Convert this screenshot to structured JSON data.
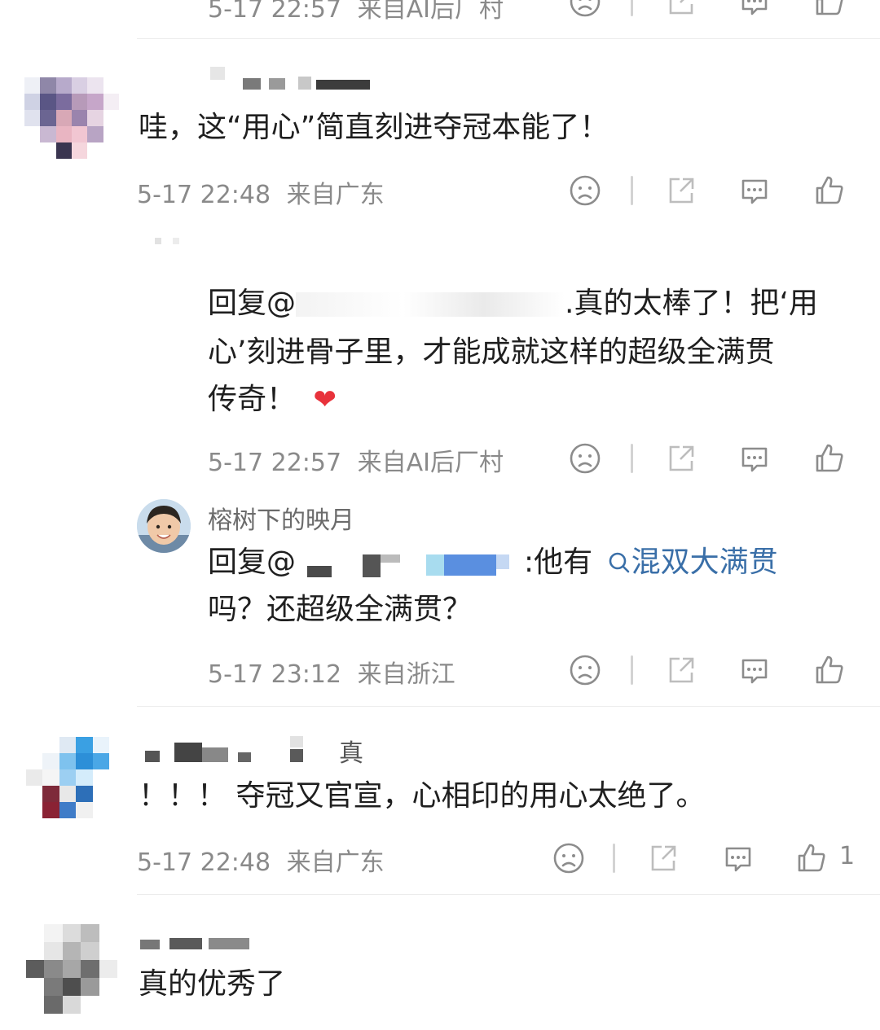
{
  "comments": [
    {
      "meta": {
        "time": "5-17 22:57",
        "location": "来自AI后厂村"
      }
    },
    {
      "text": "哇，这“用心”简直刻进夺冠本能了！",
      "meta": {
        "time": "5-17 22:48",
        "location": "来自广东"
      }
    },
    {
      "reply_prefix": "回复@",
      "reply_line1_tail": ".真的太棒了！把‘用",
      "reply_line2": "心’刻进骨子里，才能成就这样的超级全满贯",
      "reply_line3": "传奇！",
      "heart": "❤",
      "meta": {
        "time": "5-17 22:57",
        "location": "来自AI后厂村"
      }
    },
    {
      "username": "榕树下的映月",
      "reply_prefix": "回复@",
      "reply_line1_tail": ":他有",
      "search_link": "混双大满贯",
      "reply_line2": "吗？还超级全满贯？",
      "meta": {
        "time": "5-17 23:12",
        "location": "来自浙江"
      }
    },
    {
      "username_tail": "真",
      "text": "！！！ 夺冠又官宣，心相印的用心太绝了。",
      "meta": {
        "time": "5-17 22:48",
        "location": "来自广东"
      },
      "like_count": "1"
    },
    {
      "text": "真的优秀了"
    }
  ],
  "icons": [
    "sad-face-icon",
    "share-icon",
    "comment-icon",
    "thumbs-up-icon",
    "search-icon",
    "heart-icon"
  ],
  "colors": {
    "text": "#1f1f1f",
    "meta": "#8a8a8a",
    "link": "#3a6fa8",
    "heart": "#e8323b",
    "icon": "#8c8c8c"
  }
}
